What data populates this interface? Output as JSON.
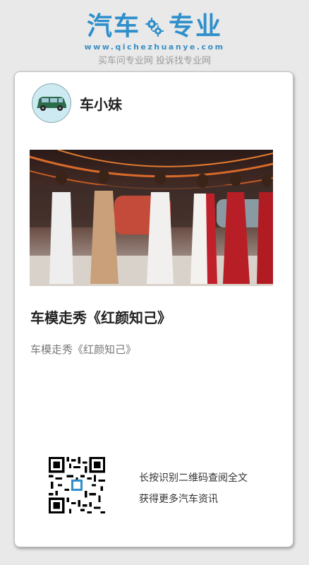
{
  "brand": {
    "title_left": "汽车",
    "title_right": "专业",
    "url": "www.qichezhuanye.com",
    "slogan": "买车问专业网 投诉找专业网",
    "color": "#2f8fcb"
  },
  "author": {
    "name": "车小妹",
    "avatar_icon": "car-avatar-icon"
  },
  "article": {
    "image_alt": "车模走秀照片",
    "title": "车模走秀《红颜知己》",
    "summary": "车模走秀《红颜知己》"
  },
  "qr": {
    "line1": "长按识别二维码查阅全文",
    "line2": "获得更多汽车资讯"
  }
}
